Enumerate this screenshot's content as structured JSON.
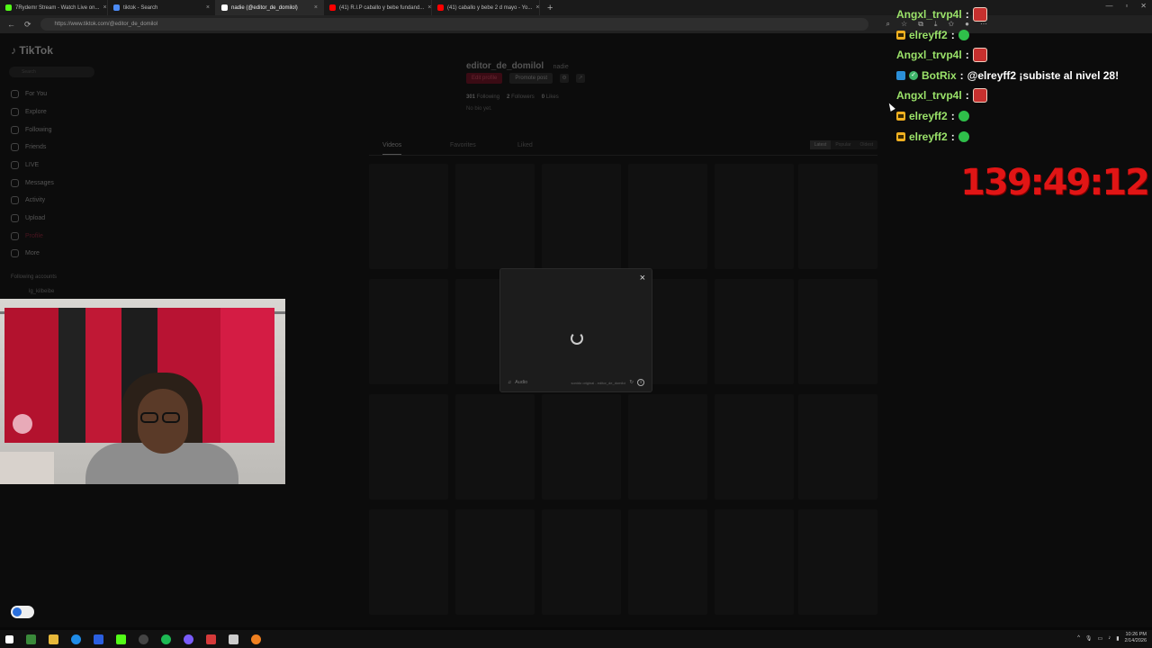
{
  "browser": {
    "tabs": [
      {
        "title": "7Rydemr Stream - Watch Live on...",
        "color": "#53fc18"
      },
      {
        "title": "tiktok - Search",
        "color": "#4c8bf5"
      },
      {
        "title": "nadie (@editor_de_domilol)",
        "color": "#ffffff"
      },
      {
        "title": "(41) R.I.P caballo y bebe fundand...",
        "color": "#ff0000"
      },
      {
        "title": "(41) caballo y bebe 2 d mayo - Yo...",
        "color": "#ff0000"
      }
    ],
    "url": "https://www.tiktok.com/@editor_de_domilol"
  },
  "tiktok": {
    "logo": "TikTok",
    "search_placeholder": "Search",
    "nav": [
      {
        "label": "For You",
        "icon": "home-icon"
      },
      {
        "label": "Explore",
        "icon": "compass-icon"
      },
      {
        "label": "Following",
        "icon": "following-icon"
      },
      {
        "label": "Friends",
        "icon": "friends-icon"
      },
      {
        "label": "LIVE",
        "icon": "live-icon"
      },
      {
        "label": "Messages",
        "icon": "messages-icon"
      },
      {
        "label": "Activity",
        "icon": "activity-icon"
      },
      {
        "label": "Upload",
        "icon": "upload-icon"
      },
      {
        "label": "Profile",
        "icon": "profile-icon"
      },
      {
        "label": "More",
        "icon": "more-icon"
      }
    ],
    "following_accounts_label": "Following accounts",
    "following_account": "lg_kilbeibe",
    "profile": {
      "username": "editor_de_domilol",
      "nickname": "nadie",
      "edit_label": "Edit profile",
      "promote_label": "Promote post",
      "following_count": "301",
      "following_label": "Following",
      "followers_count": "2",
      "followers_label": "Followers",
      "likes_count": "0",
      "likes_label": "Likes",
      "bio": "No bio yet."
    },
    "tabs": [
      "Videos",
      "Favorites",
      "Liked"
    ],
    "sort": [
      "Latest",
      "Popular",
      "Oldest"
    ]
  },
  "modal": {
    "audio_label": "Audio",
    "track": "sonido original - editor_de_domilol"
  },
  "chat": [
    {
      "user": "Angxl_trvp4l",
      "badge": "none",
      "text": "",
      "emote": "red-emote"
    },
    {
      "user": "elreyff2",
      "badge": "crown",
      "text": "",
      "emote": "green-emote"
    },
    {
      "user": "Angxl_trvp4l",
      "badge": "none",
      "text": "",
      "emote": "red-emote"
    },
    {
      "user": "BotRix",
      "badge": "bot",
      "text": "@elreyff2 ¡subiste al nivel 28!",
      "emote": "none"
    },
    {
      "user": "Angxl_trvp4l",
      "badge": "none",
      "text": "",
      "emote": "red-emote"
    },
    {
      "user": "elreyff2",
      "badge": "crown",
      "text": "",
      "emote": "green-emote"
    },
    {
      "user": "elreyff2",
      "badge": "crown",
      "text": "",
      "emote": "green-emote"
    }
  ],
  "timer": "139:49:12",
  "taskbar": {
    "time": "10:26 PM",
    "date": "2/14/2026"
  },
  "colors": {
    "chat_user": "#9be36a",
    "timer": "#e11515",
    "tiktok_accent": "#fe2c55"
  }
}
